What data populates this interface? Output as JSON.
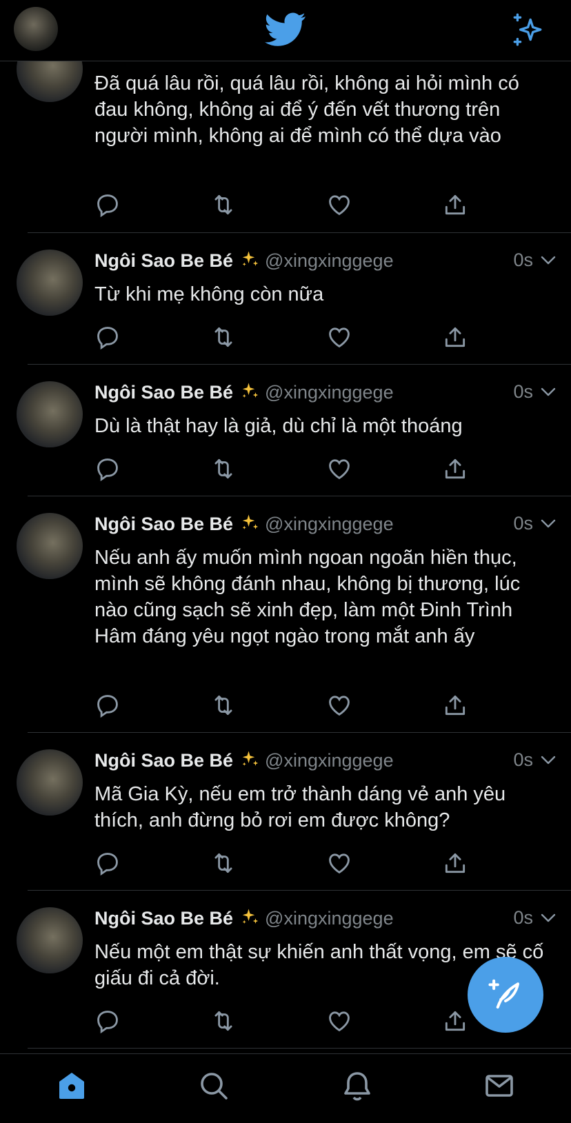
{
  "colors": {
    "accent": "#4b9fe8",
    "background": "#000000",
    "muted": "#7f858a",
    "text": "#e7e9ea"
  },
  "header": {
    "logo_icon": "twitter-bird-icon",
    "profile_icon": "avatar",
    "sparkle_icon": "sparkle-icon"
  },
  "tweets": [
    {
      "name": "",
      "handle": "",
      "time": "",
      "text": "Đã quá lâu rồi, quá lâu rồi, không ai hỏi mình có đau không, không ai để ý đến vết thương trên người mình, không ai để mình có thể dựa vào"
    },
    {
      "name": "Ngôi Sao Be Bé",
      "handle": "@xingxinggege",
      "time": "0s",
      "text": "Từ khi mẹ không còn nữa"
    },
    {
      "name": "Ngôi Sao Be Bé",
      "handle": "@xingxinggege",
      "time": "0s",
      "text": "Dù là thật hay là giả, dù chỉ là một thoáng"
    },
    {
      "name": "Ngôi Sao Be Bé",
      "handle": "@xingxinggege",
      "time": "0s",
      "text": "Nếu anh ấy muốn mình ngoan ngoãn hiền thục, mình sẽ không đánh nhau, không bị thương, lúc nào cũng sạch sẽ xinh đẹp, làm một Đinh Trình Hâm đáng yêu ngọt ngào trong mắt anh ấy"
    },
    {
      "name": "Ngôi Sao Be Bé",
      "handle": "@xingxinggege",
      "time": "0s",
      "text": "Mã Gia Kỳ, nếu em trở thành dáng vẻ anh yêu thích, anh đừng bỏ rơi em được không?"
    },
    {
      "name": "Ngôi Sao Be Bé",
      "handle": "@xingxinggege",
      "time": "0s",
      "text": "Nếu một em thật sự khiến anh thất vọng, em sẽ cố giấu đi cả đời."
    }
  ],
  "tabbar": {
    "items": [
      "home-icon",
      "search-icon",
      "notifications-icon",
      "messages-icon"
    ],
    "active": "home-icon"
  },
  "fab": {
    "icon": "compose-tweet-icon"
  }
}
